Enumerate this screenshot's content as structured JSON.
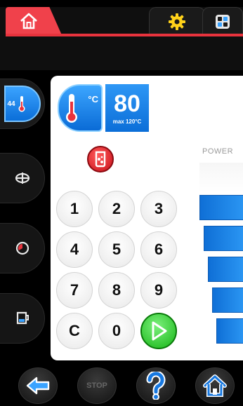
{
  "header": {
    "home_tab_icon": "home-icon",
    "settings_tab_icon": "gear-icon",
    "apps_tab_icon": "apps-grid-icon"
  },
  "sidebar": {
    "items": [
      {
        "name": "temperature",
        "value": "44",
        "icon": "thermometer-icon",
        "active": true
      },
      {
        "name": "stirrer",
        "icon": "stirrer-icon"
      },
      {
        "name": "timer",
        "icon": "timer-icon"
      },
      {
        "name": "container",
        "icon": "cup-icon"
      }
    ]
  },
  "temperature": {
    "unit": "°C",
    "setpoint": "80",
    "max_label": "max 120°C"
  },
  "keypad": {
    "keys": [
      "1",
      "2",
      "3",
      "4",
      "5",
      "6",
      "7",
      "8",
      "9",
      "C",
      "0"
    ],
    "start_icon": "play-icon"
  },
  "power": {
    "label": "POWER",
    "level_bars": 5
  },
  "footer": {
    "back_icon": "back-arrow-icon",
    "stop_label": "STOP",
    "help_icon": "help-icon",
    "home_icon": "home-icon"
  },
  "colors": {
    "accent_red": "#e8333d",
    "accent_blue": "#0b6ed8",
    "start_green": "#16b516"
  }
}
